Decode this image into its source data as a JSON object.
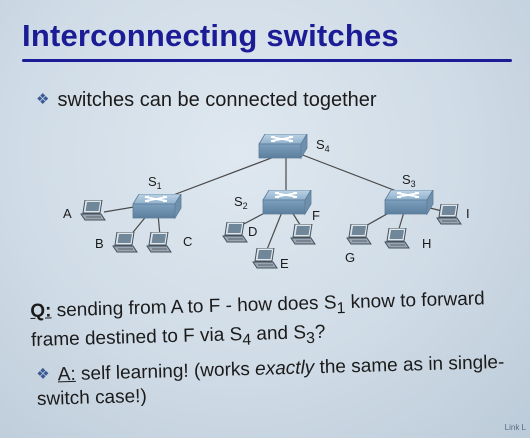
{
  "title": "Interconnecting switches",
  "bullet1": "switches can be connected together",
  "switches": {
    "s1": {
      "label": "S",
      "sub": "1"
    },
    "s2": {
      "label": "S",
      "sub": "2"
    },
    "s3": {
      "label": "S",
      "sub": "3"
    },
    "s4": {
      "label": "S",
      "sub": "4"
    }
  },
  "hosts": {
    "a": "A",
    "b": "B",
    "c": "C",
    "d": "D",
    "e": "E",
    "f": "F",
    "g": "G",
    "h": "H",
    "i": "I"
  },
  "question": {
    "marker": "Q:",
    "text_1": " sending from A to F - how does S",
    "sub_1": "1",
    "text_2": " know to forward frame destined to F via S",
    "sub_4": "4",
    "text_3": " and S",
    "sub_3": "3",
    "text_4": "?"
  },
  "answer": {
    "marker": "A:",
    "text_1": " self learning! (works ",
    "emph": "exactly",
    "text_2": " the same as in single-switch case!)"
  },
  "footer": "Link L"
}
